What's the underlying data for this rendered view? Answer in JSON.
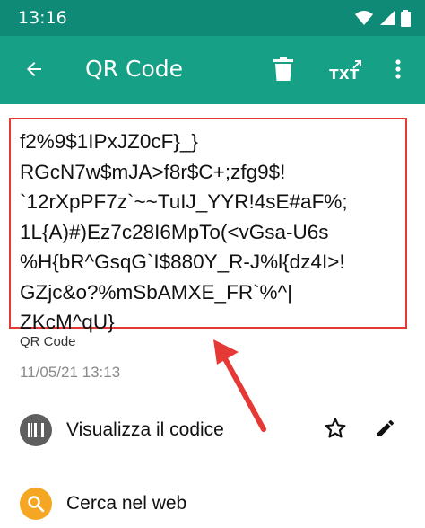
{
  "status_bar": {
    "time": "13:16",
    "icons": [
      "wifi-icon",
      "signal-icon",
      "battery-icon"
    ]
  },
  "app_bar": {
    "title": "QR Code",
    "txt_label": "TXT",
    "icons": [
      "back-arrow-icon",
      "delete-icon",
      "txt-export-icon",
      "more-vert-icon"
    ]
  },
  "code": {
    "lines": [
      "f2%9$1IPxJZ0cF}_}",
      "RGcN7w$mJA>f8r$C+;zfg9$!",
      "`12rXpPF7z`~~TuIJ_YYR!4sE#aF%;",
      "1L{A)#)Ez7c28I6MpTo(<vGsa-U6s",
      "%H{bR^GsqG`I$880Y_R-J%l{dz4I>!",
      "GZjc&o?%mSbAMXE_FR`%^|",
      "ZKcM^qU}"
    ],
    "format": "QR Code",
    "date": "11/05/21 13:13"
  },
  "actions": [
    {
      "label": "Visualizza il codice",
      "icon": "barcode-icon"
    },
    {
      "label": "Cerca nel web",
      "icon": "search-icon"
    }
  ],
  "colors": {
    "status_bar": "#0e8a76",
    "app_bar": "#16a085",
    "highlight": "#e53935",
    "search_circle": "#f5a623",
    "barcode_circle": "#5f5f5f"
  }
}
